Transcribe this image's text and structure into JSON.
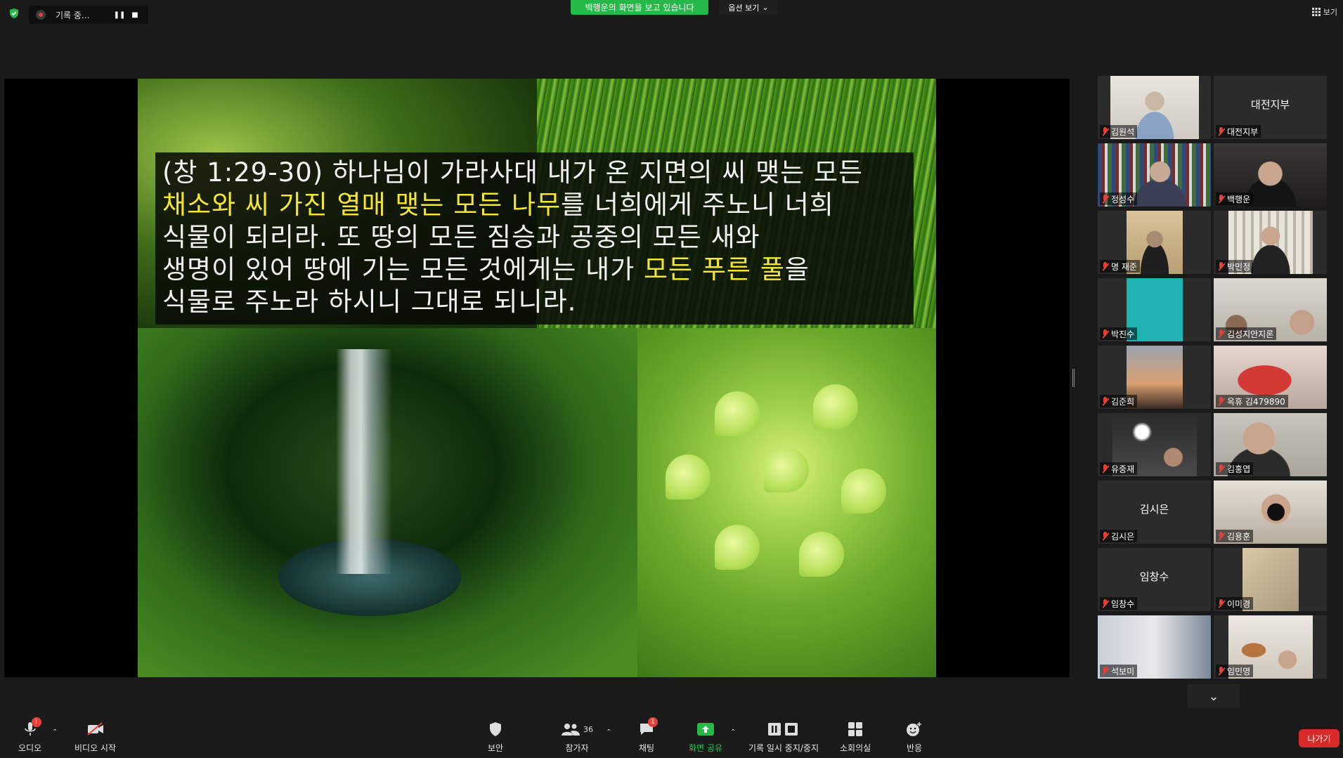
{
  "topbar": {
    "recording_text": "기록 중...",
    "share_banner": "백행운의 화면을 보고 있습니다",
    "view_options": "옵션 보기",
    "view_button": "보기"
  },
  "slide": {
    "lines": [
      [
        {
          "t": "(창 1:29-30) 하나님이 가라사대 내가 온 지면의 씨 맺는 모든",
          "h": false
        }
      ],
      [
        {
          "t": "채소와 씨 가진 열매 맺는 모든 나무",
          "h": true
        },
        {
          "t": "를 너희에게 주노니 너희",
          "h": false
        }
      ],
      [
        {
          "t": "식물이 되리라. 또 땅의 모든 짐승과 공중의 모든 새와",
          "h": false
        }
      ],
      [
        {
          "t": "생명이 있어 땅에 기는 모든 것에게는 내가 ",
          "h": false
        },
        {
          "t": "모든 푸른 풀",
          "h": true
        },
        {
          "t": "을",
          "h": false
        }
      ],
      [
        {
          "t": "식물로 주노라 하시니 그대로 되니라.",
          "h": false
        }
      ]
    ]
  },
  "participants": [
    {
      "name": "김원석",
      "big": "",
      "video": "person-grey"
    },
    {
      "name": "대전지부",
      "big": "대전지부",
      "video": ""
    },
    {
      "name": "정성수",
      "big": "",
      "video": "bookshelf"
    },
    {
      "name": "백행운",
      "big": "",
      "video": "person-dark",
      "active": true
    },
    {
      "name": "명 재준",
      "big": "",
      "video": "person-warm"
    },
    {
      "name": "박민정",
      "big": "",
      "video": "person-shelf"
    },
    {
      "name": "박진수",
      "big": "",
      "video": "teal"
    },
    {
      "name": "김성지안지론",
      "big": "",
      "video": "room-light"
    },
    {
      "name": "김준희",
      "big": "",
      "video": "sunset"
    },
    {
      "name": "옥휴 김479890",
      "big": "",
      "video": "red-blur"
    },
    {
      "name": "유중재",
      "big": "",
      "video": "person-lamp"
    },
    {
      "name": "김홍엽",
      "big": "",
      "video": "person-wall"
    },
    {
      "name": "김시은",
      "big": "김시은",
      "video": ""
    },
    {
      "name": "김용훈",
      "big": "",
      "video": "person-mask"
    },
    {
      "name": "임창수",
      "big": "임창수",
      "video": ""
    },
    {
      "name": "이미경",
      "big": "",
      "video": "beige"
    },
    {
      "name": "석보미",
      "big": "",
      "video": "room-blue"
    },
    {
      "name": "임민영",
      "big": "",
      "video": "person-guitar"
    }
  ],
  "toolbar": {
    "audio": "오디오",
    "audio_badge": "!",
    "video": "비디오 시작",
    "security": "보안",
    "participants": "참가자",
    "participant_count": "36",
    "chat": "채팅",
    "chat_badge": "1",
    "share": "화면 공유",
    "record": "기록 일시 중지/중지",
    "breakout": "소회의실",
    "reactions": "반응",
    "leave": "나가기"
  },
  "colors": {
    "share_green": "#26b94a",
    "highlight_yellow": "#f5e634",
    "active_speaker": "#f6f170",
    "leave_red": "#d62b29"
  }
}
